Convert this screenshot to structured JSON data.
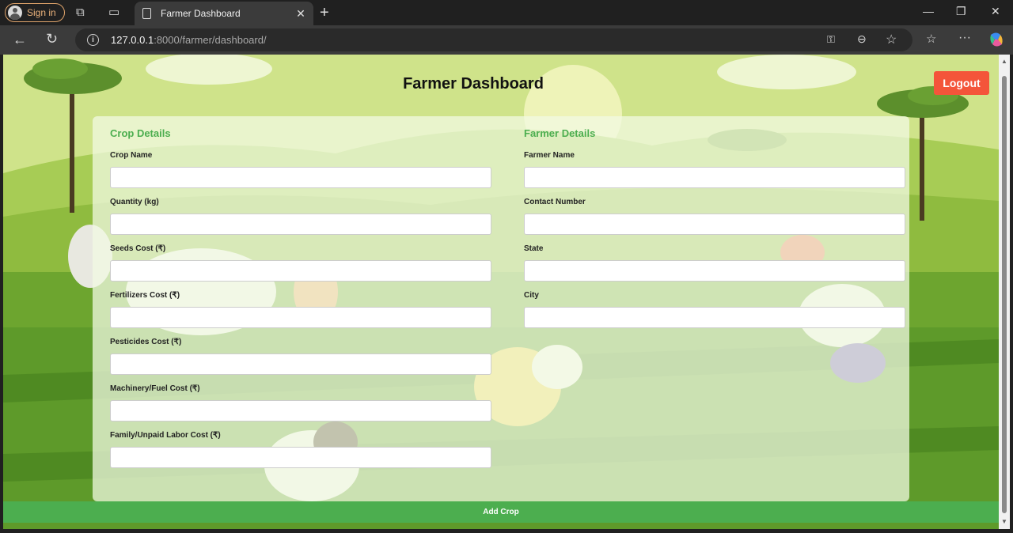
{
  "browser": {
    "sign_in_label": "Sign in",
    "tab_title": "Farmer Dashboard",
    "url_host": "127.0.0.1",
    "url_path": ":8000/farmer/dashboard/"
  },
  "page": {
    "title": "Farmer Dashboard",
    "logout_label": "Logout",
    "submit_label": "Add Crop"
  },
  "crop_section": {
    "title": "Crop Details",
    "fields": [
      {
        "label": "Crop Name",
        "value": ""
      },
      {
        "label": "Quantity (kg)",
        "value": ""
      },
      {
        "label": "Seeds Cost (₹)",
        "value": ""
      },
      {
        "label": "Fertilizers Cost (₹)",
        "value": ""
      },
      {
        "label": "Pesticides Cost (₹)",
        "value": ""
      },
      {
        "label": "Machinery/Fuel Cost (₹)",
        "value": ""
      },
      {
        "label": "Family/Unpaid Labor Cost (₹)",
        "value": ""
      }
    ]
  },
  "farmer_section": {
    "title": "Farmer Details",
    "fields": [
      {
        "label": "Farmer Name",
        "value": ""
      },
      {
        "label": "Contact Number",
        "value": ""
      },
      {
        "label": "State",
        "value": ""
      },
      {
        "label": "City",
        "value": ""
      }
    ]
  },
  "colors": {
    "accent_green": "#4cae4f",
    "logout_red": "#f4553a"
  }
}
